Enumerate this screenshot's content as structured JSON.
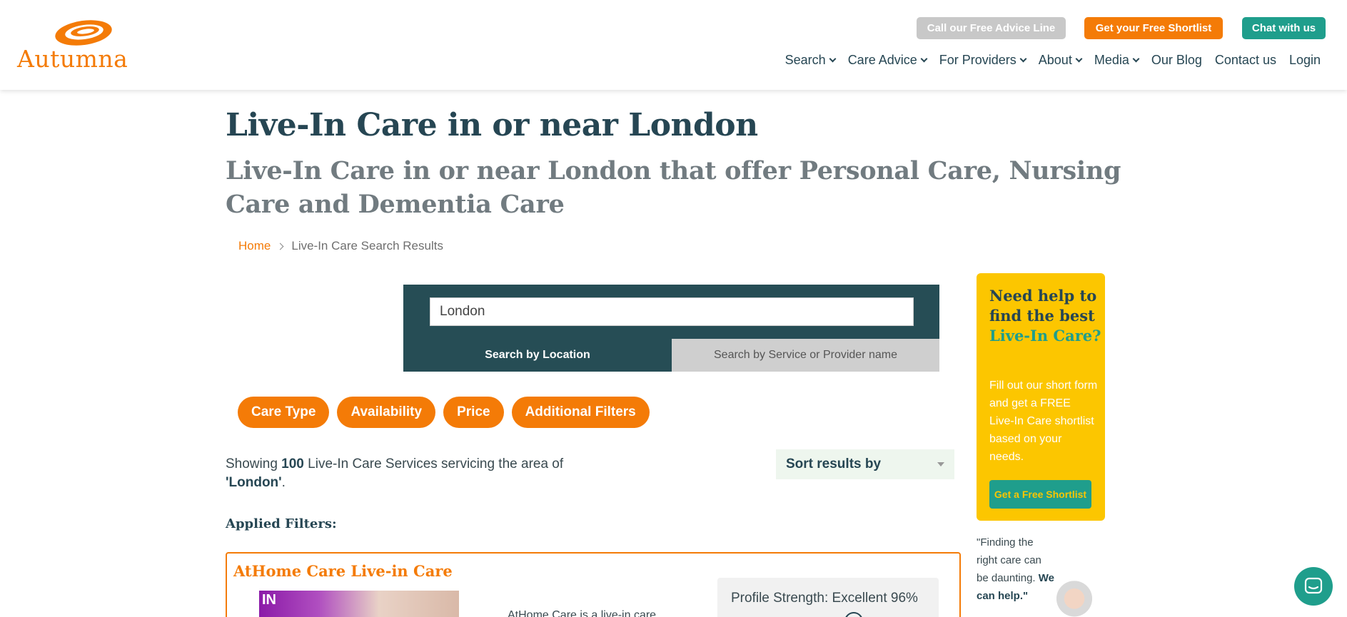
{
  "brand": {
    "name": "Autumna",
    "accent": "#f47b07",
    "dark": "#264653",
    "teal": "#1f9e8c",
    "yellow": "#fcc600"
  },
  "header": {
    "advice_btn": "Call our Free Advice Line",
    "shortlist_btn": "Get your Free Shortlist",
    "chat_btn": "Chat with us",
    "nav": [
      {
        "label": "Search",
        "dropdown": true
      },
      {
        "label": "Care Advice",
        "dropdown": true
      },
      {
        "label": "For Providers",
        "dropdown": true
      },
      {
        "label": "About",
        "dropdown": true
      },
      {
        "label": "Media",
        "dropdown": true
      },
      {
        "label": "Our Blog",
        "dropdown": false
      },
      {
        "label": "Contact us",
        "dropdown": false
      },
      {
        "label": "Login",
        "dropdown": false
      }
    ]
  },
  "page": {
    "title": "Live-In Care in or near London",
    "subtitle": "Live-In Care in or near London that offer Personal Care, Nursing Care and Dementia Care"
  },
  "breadcrumb": {
    "home": "Home",
    "current": "Live-In Care Search Results"
  },
  "search": {
    "value": "London",
    "tab_location": "Search by Location",
    "tab_service": "Search by Service or Provider name"
  },
  "filters": [
    "Care Type",
    "Availability",
    "Price",
    "Additional Filters"
  ],
  "results": {
    "prefix": "Showing",
    "count": "100",
    "middle": "Live-In Care Services servicing the area of",
    "area": "'London'",
    "suffix": ".",
    "sort_label": "Sort results by",
    "applied_label": "Applied Filters:"
  },
  "card": {
    "title": "AtHome Care Live-in Care",
    "image_text": "IN",
    "description": "AtHome Care is a live-in care",
    "strength": "Profile Strength: Excellent 96%"
  },
  "sidebar": {
    "title_a": "Need help to find the best",
    "title_b": "Live-In Care?",
    "body": "Fill out our short form and get a FREE Live-In Care shortlist based on your needs.",
    "button": "Get a Free Shortlist"
  },
  "quote": {
    "text": "\"Finding the right care can be daunting.",
    "strong": "We can help.\""
  }
}
